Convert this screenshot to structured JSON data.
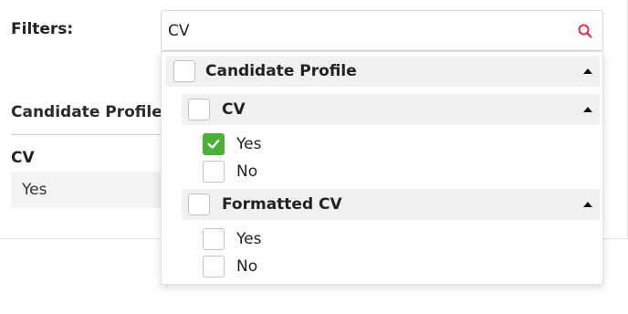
{
  "background": {
    "filters_label": "Filters:",
    "section_heading": "Candidate Profile",
    "field_label": "CV",
    "field_value": "Yes"
  },
  "search": {
    "value": "CV",
    "icon": "search-icon"
  },
  "dropdown": {
    "group": {
      "label": "Candidate Profile",
      "checked": false,
      "expanded": true,
      "subgroups": [
        {
          "label": "CV",
          "checked": false,
          "expanded": true,
          "options": [
            {
              "label": "Yes",
              "checked": true
            },
            {
              "label": "No",
              "checked": false
            }
          ]
        },
        {
          "label": "Formatted CV",
          "checked": false,
          "expanded": true,
          "options": [
            {
              "label": "Yes",
              "checked": false
            },
            {
              "label": "No",
              "checked": false
            }
          ]
        }
      ]
    }
  },
  "colors": {
    "accent_check": "#4caf38",
    "search_icon": "#d9304f",
    "group_row_bg": "#f1f1f3"
  }
}
